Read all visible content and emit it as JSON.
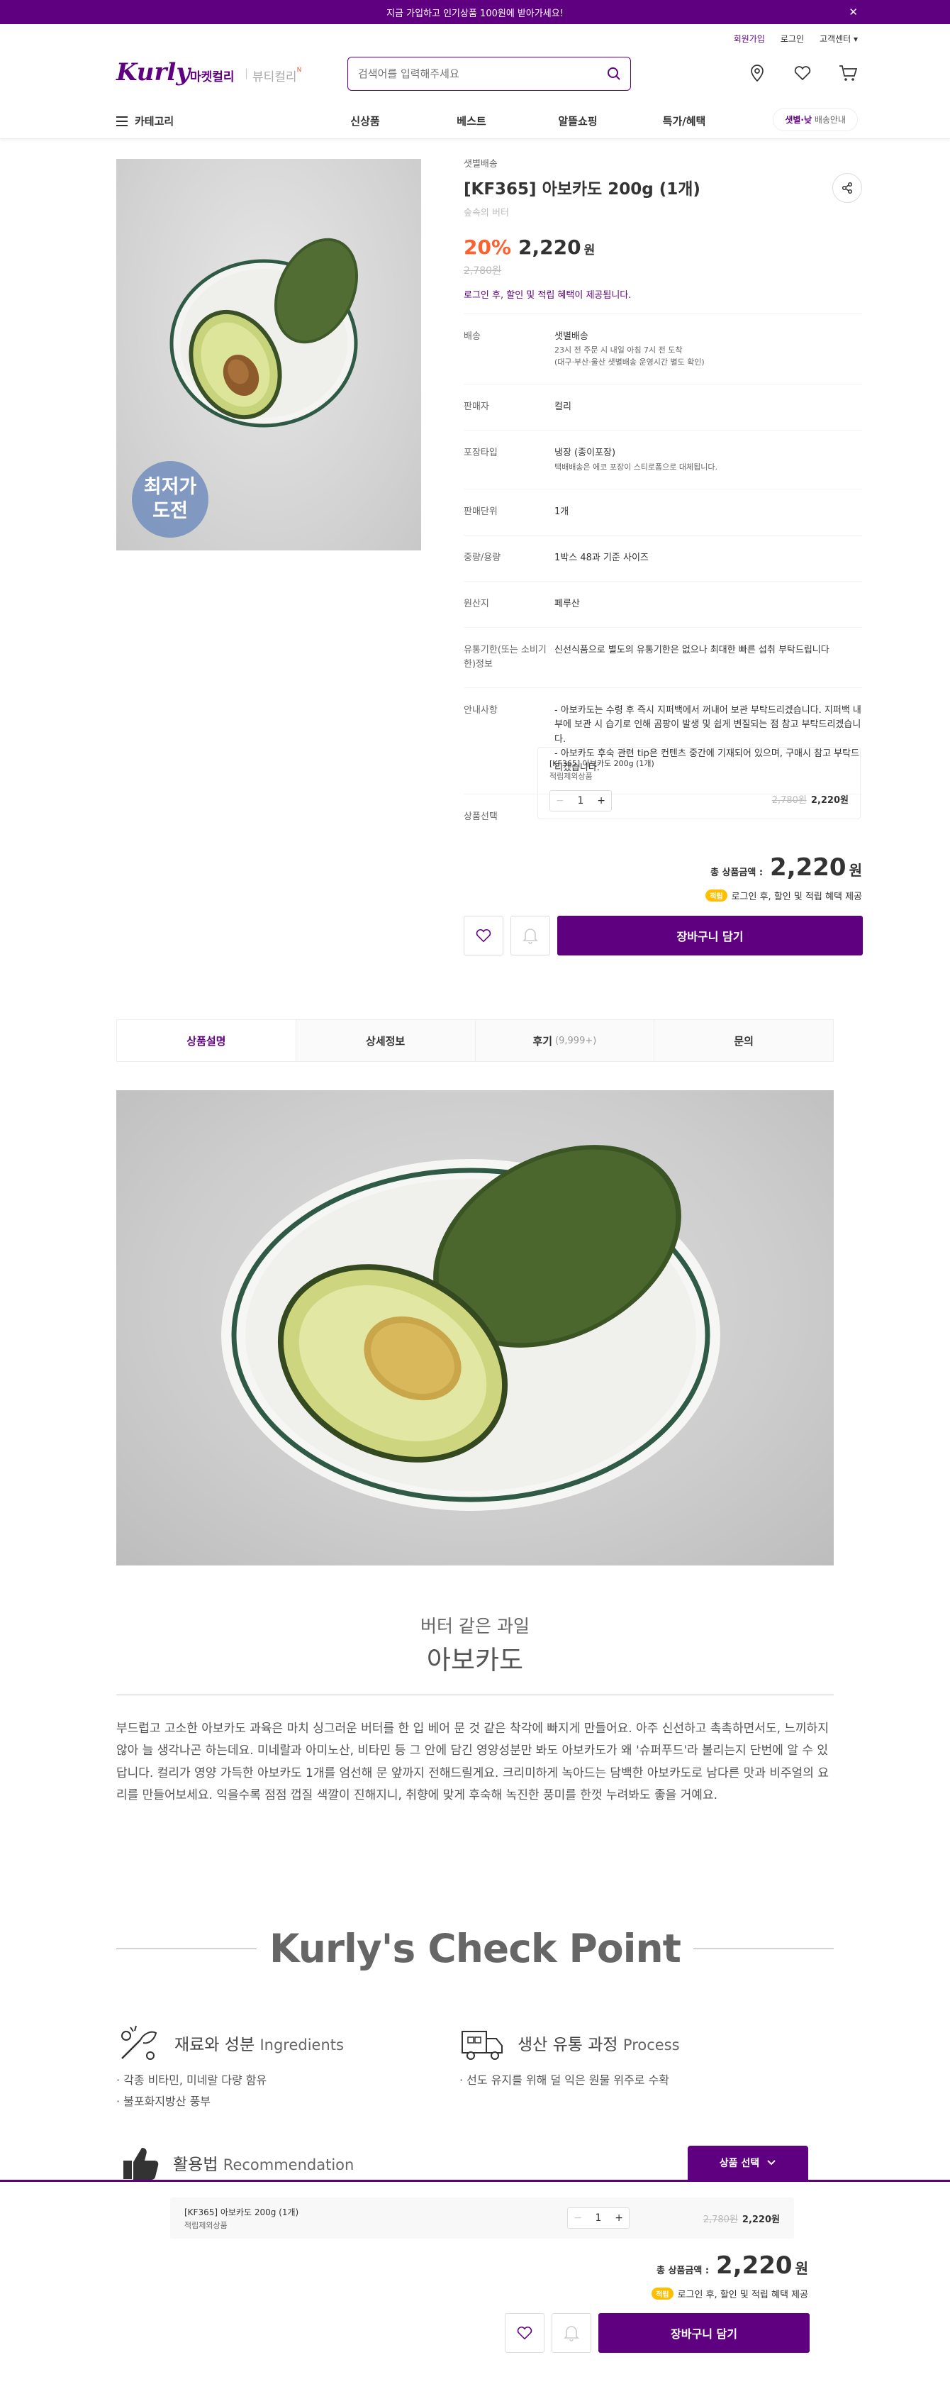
{
  "banner": {
    "text": "지금 가입하고 인기상품 100원에 받아가세요!",
    "close": "✕"
  },
  "user_links": {
    "signup": "회원가입",
    "login": "로그인",
    "cs": "고객센터 ▾"
  },
  "logo": {
    "text": "Kurly",
    "market": "마켓컬리",
    "beauty": "뷰티컬리",
    "beauty_new": "N"
  },
  "search": {
    "placeholder": "검색어를 입력해주세요"
  },
  "gnb": {
    "category": "카테고리",
    "menu": [
      "신상품",
      "베스트",
      "알뜰쇼핑",
      "특가/혜택"
    ],
    "delivery_strong": "샛별·낮",
    "delivery_rest": " 배송안내"
  },
  "product": {
    "badge": "최저가\n도전",
    "shipping_type": "샛별배송",
    "title": "[KF365] 아보카도 200g (1개)",
    "subtitle": "숲속의 버터",
    "discount_rate": "20%",
    "price": "2,220",
    "won": "원",
    "original_price": "2,780원",
    "login_msg": "로그인 후, 할인 및 적립 혜택이 제공됩니다.",
    "info_rows": [
      {
        "k": "배송",
        "v": "샛별배송",
        "s1": "23시 전 주문 시 내일 아침 7시 전 도착",
        "s2": "(대구·부산·울산 샛별배송 운영시간 별도 확인)"
      },
      {
        "k": "판매자",
        "v": "컬리",
        "s1": "",
        "s2": ""
      },
      {
        "k": "포장타입",
        "v": "냉장 (종이포장)",
        "s1": "택배배송은 에코 포장이 스티로폼으로 대체됩니다.",
        "s2": ""
      },
      {
        "k": "판매단위",
        "v": "1개",
        "s1": "",
        "s2": ""
      },
      {
        "k": "중량/용량",
        "v": "1박스 48과 기준 사이즈",
        "s1": "",
        "s2": ""
      },
      {
        "k": "원산지",
        "v": "페루산",
        "s1": "",
        "s2": ""
      },
      {
        "k": "유통기한(또는 소비기한)정보",
        "v": "신선식품으로 별도의 유통기한은 없으나 최대한 빠른 섭취 부탁드립니다",
        "s1": "",
        "s2": ""
      },
      {
        "k": "안내사항",
        "v": "- 아보카도는 수령 후 즉시 지퍼백에서 꺼내어 보관 부탁드리겠습니다. 지퍼백 내부에 보관 시 습기로 인해 곰팡이 발생 및 쉽게 변질되는 점 참고 부탁드리겠습니다.\n- 아보카도 후숙 관련 tip은 컨텐츠 중간에 기재되어 있으며, 구매시 참고 부탁드리겠습니다.",
        "s1": "",
        "s2": ""
      }
    ],
    "option_label": "상품선택",
    "option_name": "[KF365] 아보카도 200g (1개)",
    "option_sub": "적립제외상품",
    "quantity": "1",
    "option_orig": "2,780원",
    "option_price": "2,220원",
    "total_label": "총 상품금액 :",
    "total_value": "2,220",
    "total_won": "원",
    "point_tag": "적립",
    "point_text": "로그인 후, 할인 및 적립 혜택 제공",
    "cart_button": "장바구니 담기"
  },
  "tabs": [
    {
      "label": "상품설명",
      "count": ""
    },
    {
      "label": "상세정보",
      "count": ""
    },
    {
      "label": "후기",
      "count": "(9,999+)"
    },
    {
      "label": "문의",
      "count": ""
    }
  ],
  "detail": {
    "subtitle": "버터 같은 과일",
    "title": "아보카도",
    "text": "부드럽고 고소한 아보카도 과육은 마치 싱그러운 버터를 한 입 베어 문 것 같은 착각에 빠지게 만들어요. 아주 신선하고 촉촉하면서도, 느끼하지 않아 늘 생각나곤 하는데요. 미네랄과 아미노산, 비타민 등 그 안에 담긴 영양성분만 봐도 아보카도가 왜 '슈퍼푸드'라 불리는지 단번에 알 수 있답니다. 컬리가 영양 가득한 아보카도 1개를 엄선해 문 앞까지 전해드릴게요. 크리미하게 녹아드는 담백한 아보카도로 남다른 맛과 비주얼의 요리를 만들어보세요. 익을수록 점점 껍질 색깔이 진해지니, 취향에 맞게 후숙해 녹진한 풍미를 한껏 누려봐도 좋을 거예요."
  },
  "checkpoint": {
    "title": "Kurly's Check Point",
    "sections": [
      {
        "ko": "재료와 성분",
        "en": "Ingredients",
        "bullets": [
          "· 각종 비타민, 미네랄 다량 함유",
          "· 불포화지방산 풍부"
        ]
      },
      {
        "ko": "생산 유통 과정",
        "en": "Process",
        "bullets": [
          "· 선도 유지를 위해 덜 익은 원물 위주로 수확"
        ]
      },
      {
        "ko": "활용법",
        "en": "Recommendation",
        "bullets": []
      }
    ]
  },
  "sticky": {
    "option_toggle": "상품 선택"
  }
}
